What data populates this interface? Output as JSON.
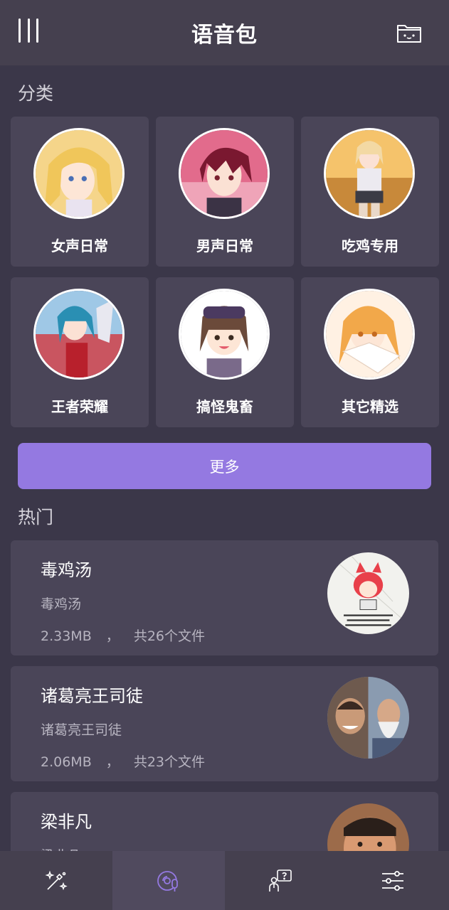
{
  "header": {
    "title": "语音包",
    "menu_icon": "menu-icon",
    "folder_icon": "folder-icon"
  },
  "categories": {
    "title": "分类",
    "items": [
      {
        "label": "女声日常"
      },
      {
        "label": "男声日常"
      },
      {
        "label": "吃鸡专用"
      },
      {
        "label": "王者荣耀"
      },
      {
        "label": "搞怪鬼畜"
      },
      {
        "label": "其它精选"
      }
    ],
    "more_label": "更多"
  },
  "hot": {
    "title": "热门",
    "items": [
      {
        "name": "毒鸡汤",
        "sub": "毒鸡汤",
        "size": "2.33MB",
        "sep": "，",
        "count": "共26个文件"
      },
      {
        "name": "诸葛亮王司徒",
        "sub": "诸葛亮王司徒",
        "size": "2.06MB",
        "sep": "，",
        "count": "共23个文件"
      },
      {
        "name": "梁非凡",
        "sub": "梁非凡",
        "size": "",
        "sep": "",
        "count": ""
      }
    ]
  },
  "tabbar": {
    "items": [
      {
        "icon": "magic-wand-icon"
      },
      {
        "icon": "voice-disc-mic-icon"
      },
      {
        "icon": "help-person-icon"
      },
      {
        "icon": "settings-sliders-icon"
      }
    ],
    "accent": "#9479e1"
  },
  "colors": {
    "background": "#3b3749",
    "card": "#4a4558",
    "header": "#45404f",
    "accent": "#9479e1"
  }
}
